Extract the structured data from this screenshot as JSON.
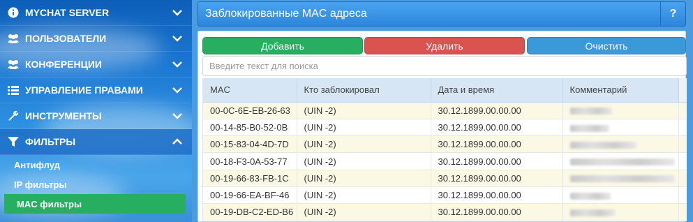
{
  "sidebar": {
    "items": [
      {
        "label": "MYCHAT SERVER",
        "icon": "info-icon",
        "chevron": "chevron-down-icon"
      },
      {
        "label": "ПОЛЬЗОВАТЕЛИ",
        "icon": "users-icon",
        "chevron": "chevron-down-icon"
      },
      {
        "label": "КОНФЕРЕНЦИИ",
        "icon": "users-icon",
        "chevron": "chevron-down-icon"
      },
      {
        "label": "УПРАВЛЕНИЕ ПРАВАМИ",
        "icon": "list-icon",
        "chevron": "chevron-down-icon"
      },
      {
        "label": "ИНСТРУМЕНТЫ",
        "icon": "wrench-icon",
        "chevron": "chevron-down-icon"
      },
      {
        "label": "ФИЛЬТРЫ",
        "icon": "filter-icon",
        "chevron": "chevron-up-icon"
      }
    ],
    "subitems": [
      {
        "label": "Антифлуд"
      },
      {
        "label": "IP фильтры"
      },
      {
        "label": "MAC фильтры",
        "selected": true
      }
    ]
  },
  "header": {
    "title": "Заблокированные MAC адреса",
    "help_label": "?"
  },
  "toolbar": {
    "add_label": "Добавить",
    "delete_label": "Удалить",
    "clear_label": "Очистить"
  },
  "search": {
    "placeholder": "Введите текст для поиска",
    "value": ""
  },
  "table": {
    "columns": [
      "MAC",
      "Кто заблокировал",
      "Дата и время",
      "Комментарий"
    ],
    "rows": [
      {
        "mac": "00-0C-6E-EB-26-63",
        "by": "(UIN -2)",
        "date": "30.12.1899.00.00.00"
      },
      {
        "mac": "00-14-85-B0-52-0B",
        "by": "(UIN -2)",
        "date": "30.12.1899.00.00.00"
      },
      {
        "mac": "00-15-83-04-4D-7D",
        "by": "(UIN -2)",
        "date": "30.12.1899.00.00.00"
      },
      {
        "mac": "00-18-F3-0A-53-77",
        "by": "(UIN -2)",
        "date": "30.12.1899.00.00.00"
      },
      {
        "mac": "00-19-66-83-FB-1C",
        "by": "(UIN -2)",
        "date": "30.12.1899.00.00.00"
      },
      {
        "mac": "00-19-66-EA-BF-46",
        "by": "(UIN -2)",
        "date": "30.12.1899.00.00.00"
      },
      {
        "mac": "00-19-DB-C2-ED-B6",
        "by": "(UIN -2)",
        "date": "30.12.1899.00.00.00"
      }
    ]
  },
  "colors": {
    "add": "#27ae60",
    "delete": "#d9534f",
    "clear": "#3a9ad9",
    "header": "#2c86dc",
    "row_alt": "#fbf9e3"
  }
}
